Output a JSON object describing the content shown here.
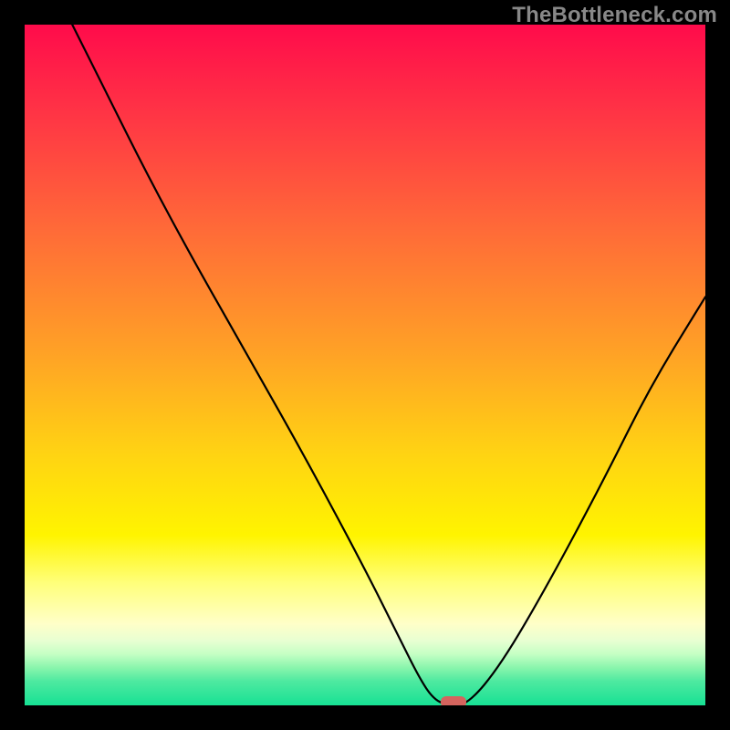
{
  "watermark": "TheBottleneck.com",
  "marker": {
    "color_hex": "#d4645e"
  },
  "chart_data": {
    "type": "line",
    "title": "",
    "xlabel": "",
    "ylabel": "",
    "xlim": [
      0,
      100
    ],
    "ylim": [
      0,
      100
    ],
    "x": [
      7,
      12,
      18,
      25,
      33,
      42,
      50,
      55,
      58,
      60,
      62,
      65,
      70,
      77,
      85,
      92,
      100
    ],
    "values": [
      100,
      90,
      78,
      65,
      51,
      35,
      20,
      10,
      4,
      1,
      0,
      0,
      6,
      18,
      33,
      47,
      60
    ],
    "series": [
      {
        "name": "bottleneck-curve",
        "values": [
          100,
          90,
          78,
          65,
          51,
          35,
          50,
          20,
          10,
          4,
          1,
          0,
          0,
          6,
          18,
          33,
          47,
          60
        ]
      }
    ],
    "marker_point": {
      "x": 63,
      "y": 0
    },
    "gradient_stops": [
      {
        "offset": 0.0,
        "color": "#ff0b4b"
      },
      {
        "offset": 0.13,
        "color": "#ff3445"
      },
      {
        "offset": 0.3,
        "color": "#ff6a38"
      },
      {
        "offset": 0.48,
        "color": "#ffa126"
      },
      {
        "offset": 0.63,
        "color": "#ffd313"
      },
      {
        "offset": 0.75,
        "color": "#fff400"
      },
      {
        "offset": 0.82,
        "color": "#ffff7a"
      },
      {
        "offset": 0.88,
        "color": "#ffffc8"
      },
      {
        "offset": 0.905,
        "color": "#e8ffd2"
      },
      {
        "offset": 0.925,
        "color": "#c4ffc4"
      },
      {
        "offset": 0.945,
        "color": "#88f5ac"
      },
      {
        "offset": 0.965,
        "color": "#4de9a0"
      },
      {
        "offset": 1.0,
        "color": "#17e194"
      }
    ]
  }
}
